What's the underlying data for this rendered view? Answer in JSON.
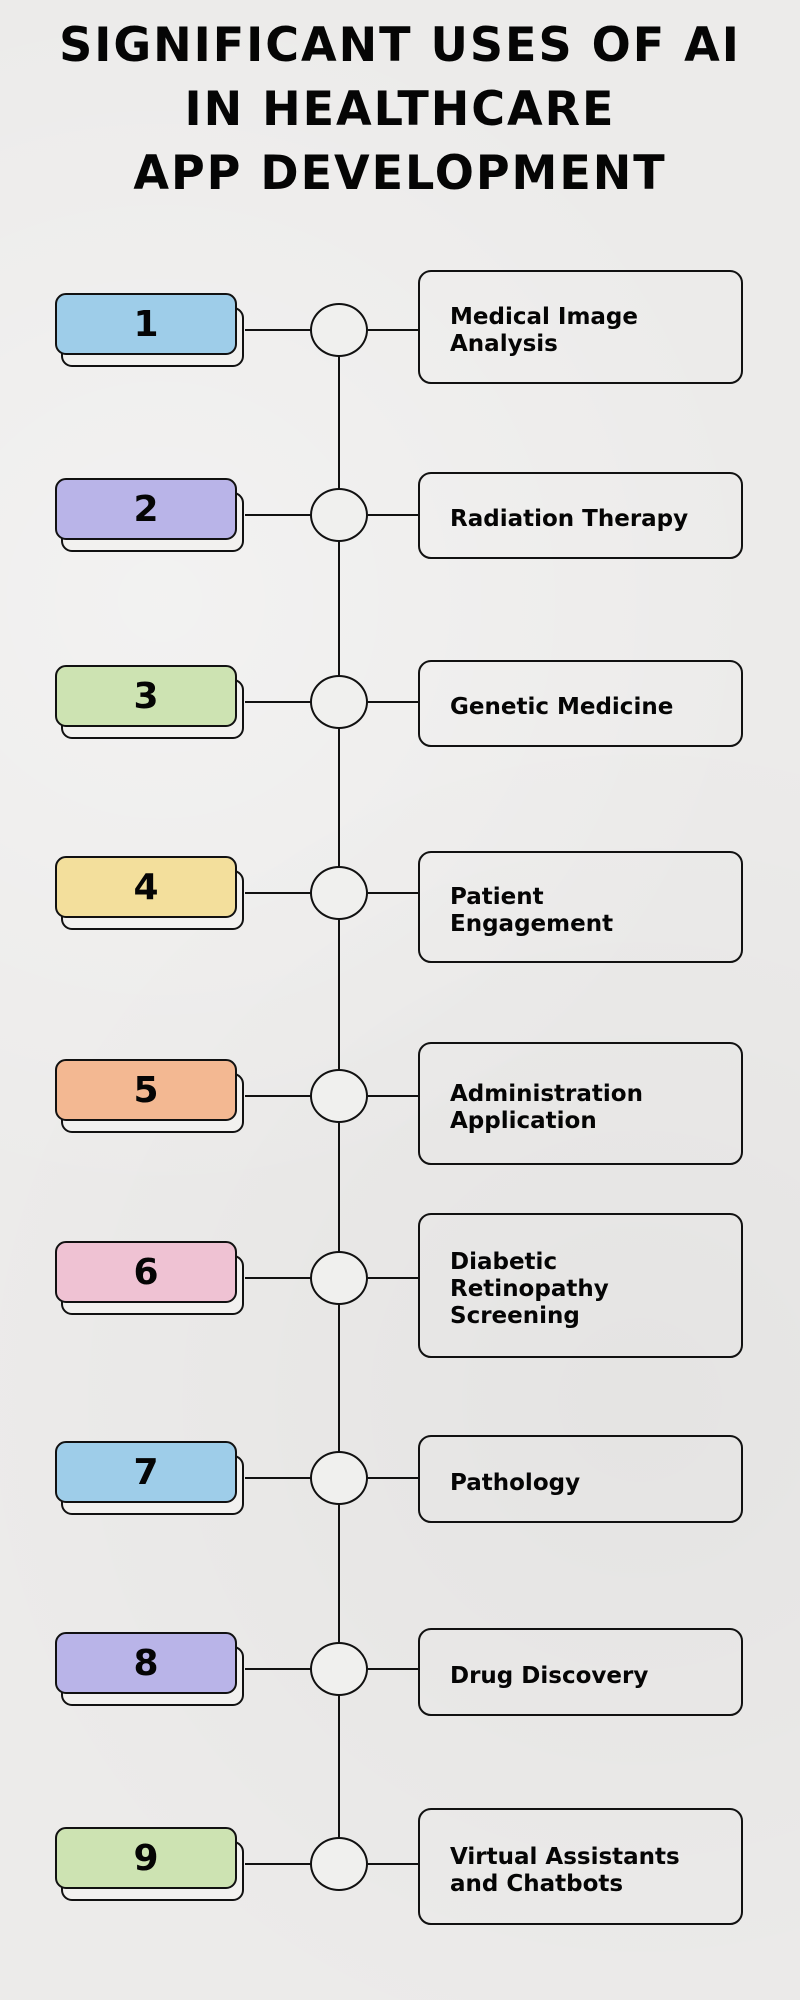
{
  "title": {
    "line1": "SIGNIFICANT USES OF AI",
    "line2": "IN HEALTHCARE",
    "line3": "APP DEVELOPMENT"
  },
  "items": [
    {
      "number": "1",
      "label_lines": [
        "Medical Image",
        "Analysis"
      ],
      "color": "#9ecde9"
    },
    {
      "number": "2",
      "label_lines": [
        "Radiation Therapy"
      ],
      "color": "#b9b4e8"
    },
    {
      "number": "3",
      "label_lines": [
        "Genetic Medicine"
      ],
      "color": "#cde3b2"
    },
    {
      "number": "4",
      "label_lines": [
        "Patient",
        "Engagement"
      ],
      "color": "#f3df9c"
    },
    {
      "number": "5",
      "label_lines": [
        "Administration",
        "Application"
      ],
      "color": "#f3b892"
    },
    {
      "number": "6",
      "label_lines": [
        "Diabetic",
        "Retinopathy",
        "Screening"
      ],
      "color": "#efc2d3"
    },
    {
      "number": "7",
      "label_lines": [
        "Pathology"
      ],
      "color": "#9ecde9"
    },
    {
      "number": "8",
      "label_lines": [
        "Drug Discovery"
      ],
      "color": "#b9b4e8"
    },
    {
      "number": "9",
      "label_lines": [
        "Virtual Assistants",
        "and Chatbots"
      ],
      "color": "#cde3b2"
    }
  ]
}
